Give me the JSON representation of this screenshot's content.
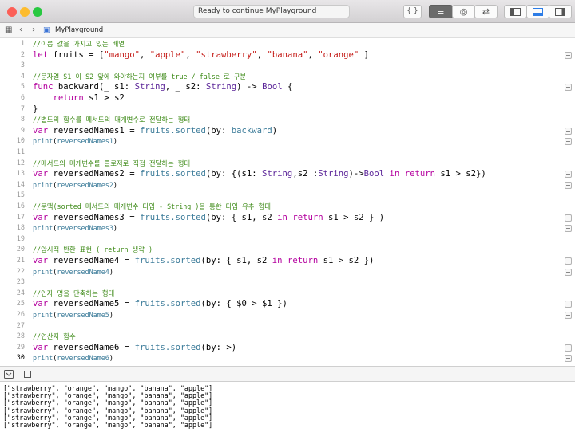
{
  "window": {
    "status": "Ready to continue MyPlayground"
  },
  "toolbar": {
    "braces_label": "{ }",
    "editor_label": "≡",
    "assistant_label": "◎",
    "version_label": "⇄"
  },
  "navbar": {
    "file_name": "MyPlayground"
  },
  "editor": {
    "current_line": 30,
    "lines": [
      {
        "n": 1,
        "size": "s",
        "tokens": [
          {
            "t": "//이름 값을 가지고 있는 배열",
            "c": "comment"
          }
        ]
      },
      {
        "n": 2,
        "size": "l",
        "tokens": [
          {
            "t": "let",
            "c": "keyword"
          },
          {
            "t": " fruits = [",
            "c": "plain"
          },
          {
            "t": "\"mango\"",
            "c": "string"
          },
          {
            "t": ", ",
            "c": "plain"
          },
          {
            "t": "\"apple\"",
            "c": "string"
          },
          {
            "t": ", ",
            "c": "plain"
          },
          {
            "t": "\"strawberry\"",
            "c": "string"
          },
          {
            "t": ", ",
            "c": "plain"
          },
          {
            "t": "\"banana\"",
            "c": "string"
          },
          {
            "t": ", ",
            "c": "plain"
          },
          {
            "t": "\"orange\"",
            "c": "string"
          },
          {
            "t": " ]",
            "c": "plain"
          }
        ]
      },
      {
        "n": 3,
        "size": "s",
        "tokens": []
      },
      {
        "n": 4,
        "size": "s",
        "tokens": [
          {
            "t": "//문자열 S1 이 S2 앞에 와야하는지 여부를 true / false 로 구분",
            "c": "comment"
          }
        ]
      },
      {
        "n": 5,
        "size": "l",
        "tokens": [
          {
            "t": "func",
            "c": "keyword"
          },
          {
            "t": " backward(_ s1: ",
            "c": "plain"
          },
          {
            "t": "String",
            "c": "type"
          },
          {
            "t": ", _ s2: ",
            "c": "plain"
          },
          {
            "t": "String",
            "c": "type"
          },
          {
            "t": ") -> ",
            "c": "plain"
          },
          {
            "t": "Bool",
            "c": "type"
          },
          {
            "t": " {",
            "c": "plain"
          }
        ]
      },
      {
        "n": 6,
        "size": "l",
        "tokens": [
          {
            "t": "    ",
            "c": "plain"
          },
          {
            "t": "return",
            "c": "keyword"
          },
          {
            "t": " s1 > s2",
            "c": "plain"
          }
        ]
      },
      {
        "n": 7,
        "size": "l",
        "tokens": [
          {
            "t": "}",
            "c": "plain"
          }
        ]
      },
      {
        "n": 8,
        "size": "s",
        "tokens": [
          {
            "t": "//별도의 함수를 메서드의 매개변수로 전달하는 형태",
            "c": "comment"
          }
        ]
      },
      {
        "n": 9,
        "size": "l",
        "tokens": [
          {
            "t": "var",
            "c": "keyword"
          },
          {
            "t": " reversedNames1 = ",
            "c": "plain"
          },
          {
            "t": "fruits.sorted",
            "c": "api"
          },
          {
            "t": "(by: ",
            "c": "plain"
          },
          {
            "t": "backward",
            "c": "api"
          },
          {
            "t": ")",
            "c": "plain"
          }
        ]
      },
      {
        "n": 10,
        "size": "s",
        "tokens": [
          {
            "t": "print",
            "c": "api"
          },
          {
            "t": "(",
            "c": "plain"
          },
          {
            "t": "reversedNames1",
            "c": "api"
          },
          {
            "t": ")",
            "c": "plain"
          }
        ]
      },
      {
        "n": 11,
        "size": "s",
        "tokens": []
      },
      {
        "n": 12,
        "size": "s",
        "tokens": [
          {
            "t": "//메서드의 매개변수를 클로저로 직접 전달하는 형태",
            "c": "comment"
          }
        ]
      },
      {
        "n": 13,
        "size": "l",
        "tokens": [
          {
            "t": "var",
            "c": "keyword"
          },
          {
            "t": " reversedNames2 = ",
            "c": "plain"
          },
          {
            "t": "fruits.sorted",
            "c": "api"
          },
          {
            "t": "(by: {(s1: ",
            "c": "plain"
          },
          {
            "t": "String",
            "c": "type"
          },
          {
            "t": ",s2 :",
            "c": "plain"
          },
          {
            "t": "String",
            "c": "type"
          },
          {
            "t": ")->",
            "c": "plain"
          },
          {
            "t": "Bool",
            "c": "type"
          },
          {
            "t": " ",
            "c": "plain"
          },
          {
            "t": "in",
            "c": "keyword"
          },
          {
            "t": " ",
            "c": "plain"
          },
          {
            "t": "return",
            "c": "keyword"
          },
          {
            "t": " s1 > s2})",
            "c": "plain"
          }
        ]
      },
      {
        "n": 14,
        "size": "s",
        "tokens": [
          {
            "t": "print",
            "c": "api"
          },
          {
            "t": "(",
            "c": "plain"
          },
          {
            "t": "reversedNames2",
            "c": "api"
          },
          {
            "t": ")",
            "c": "plain"
          }
        ]
      },
      {
        "n": 15,
        "size": "s",
        "tokens": []
      },
      {
        "n": 16,
        "size": "s",
        "tokens": [
          {
            "t": "//문맥(sorted 메서드의 매개변수 타입 - String )을 통한 타입 유추 형태",
            "c": "comment"
          }
        ]
      },
      {
        "n": 17,
        "size": "l",
        "tokens": [
          {
            "t": "var",
            "c": "keyword"
          },
          {
            "t": " reversedNames3 = ",
            "c": "plain"
          },
          {
            "t": "fruits.sorted",
            "c": "api"
          },
          {
            "t": "(by: { s1, s2 ",
            "c": "plain"
          },
          {
            "t": "in",
            "c": "keyword"
          },
          {
            "t": " ",
            "c": "plain"
          },
          {
            "t": "return",
            "c": "keyword"
          },
          {
            "t": " s1 > s2 } )",
            "c": "plain"
          }
        ]
      },
      {
        "n": 18,
        "size": "s",
        "tokens": [
          {
            "t": "print",
            "c": "api"
          },
          {
            "t": "(",
            "c": "plain"
          },
          {
            "t": "reversedNames3",
            "c": "api"
          },
          {
            "t": ")",
            "c": "plain"
          }
        ]
      },
      {
        "n": 19,
        "size": "s",
        "tokens": []
      },
      {
        "n": 20,
        "size": "s",
        "tokens": [
          {
            "t": "//암시적 반환 표현 ( return 생략 )",
            "c": "comment"
          }
        ]
      },
      {
        "n": 21,
        "size": "l",
        "tokens": [
          {
            "t": "var",
            "c": "keyword"
          },
          {
            "t": " reversedName4 = ",
            "c": "plain"
          },
          {
            "t": "fruits.sorted",
            "c": "api"
          },
          {
            "t": "(by: { s1, s2 ",
            "c": "plain"
          },
          {
            "t": "in",
            "c": "keyword"
          },
          {
            "t": " ",
            "c": "plain"
          },
          {
            "t": "return",
            "c": "keyword"
          },
          {
            "t": " s1 > s2 })",
            "c": "plain"
          }
        ]
      },
      {
        "n": 22,
        "size": "s",
        "tokens": [
          {
            "t": "print",
            "c": "api"
          },
          {
            "t": "(",
            "c": "plain"
          },
          {
            "t": "reversedName4",
            "c": "api"
          },
          {
            "t": ")",
            "c": "plain"
          }
        ]
      },
      {
        "n": 23,
        "size": "s",
        "tokens": []
      },
      {
        "n": 24,
        "size": "s",
        "tokens": [
          {
            "t": "//인자 명을 단축하는 형태",
            "c": "comment"
          }
        ]
      },
      {
        "n": 25,
        "size": "l",
        "tokens": [
          {
            "t": "var",
            "c": "keyword"
          },
          {
            "t": " reversedName5 = ",
            "c": "plain"
          },
          {
            "t": "fruits.sorted",
            "c": "api"
          },
          {
            "t": "(by: { $0 > $1 })",
            "c": "plain"
          }
        ]
      },
      {
        "n": 26,
        "size": "s",
        "tokens": [
          {
            "t": "print",
            "c": "api"
          },
          {
            "t": "(",
            "c": "plain"
          },
          {
            "t": "reversedName5",
            "c": "api"
          },
          {
            "t": ")",
            "c": "plain"
          }
        ]
      },
      {
        "n": 27,
        "size": "s",
        "tokens": []
      },
      {
        "n": 28,
        "size": "s",
        "tokens": [
          {
            "t": "//연산자 함수",
            "c": "comment"
          }
        ]
      },
      {
        "n": 29,
        "size": "l",
        "tokens": [
          {
            "t": "var",
            "c": "keyword"
          },
          {
            "t": " reversedName6 = ",
            "c": "plain"
          },
          {
            "t": "fruits.sorted",
            "c": "api"
          },
          {
            "t": "(by: >)",
            "c": "plain"
          }
        ]
      },
      {
        "n": 30,
        "size": "s",
        "tokens": [
          {
            "t": "print",
            "c": "api"
          },
          {
            "t": "(",
            "c": "plain"
          },
          {
            "t": "reversedName6",
            "c": "api"
          },
          {
            "t": ")",
            "c": "plain"
          }
        ]
      }
    ],
    "result_button_lines": [
      2,
      5,
      9,
      10,
      13,
      14,
      17,
      18,
      21,
      22,
      25,
      26,
      29,
      30
    ]
  },
  "console": {
    "lines": [
      "[\"strawberry\", \"orange\", \"mango\", \"banana\", \"apple\"]",
      "[\"strawberry\", \"orange\", \"mango\", \"banana\", \"apple\"]",
      "[\"strawberry\", \"orange\", \"mango\", \"banana\", \"apple\"]",
      "[\"strawberry\", \"orange\", \"mango\", \"banana\", \"apple\"]",
      "[\"strawberry\", \"orange\", \"mango\", \"banana\", \"apple\"]",
      "[\"strawberry\", \"orange\", \"mango\", \"banana\", \"apple\"]"
    ]
  },
  "colors": {
    "keyword": "#b4009e",
    "string": "#c41a16",
    "type": "#5c2699",
    "api": "#3b7b99",
    "comment": "#3d8a17",
    "close": "#fc5f57",
    "minimize": "#fdbc2e",
    "zoom": "#28c840"
  }
}
